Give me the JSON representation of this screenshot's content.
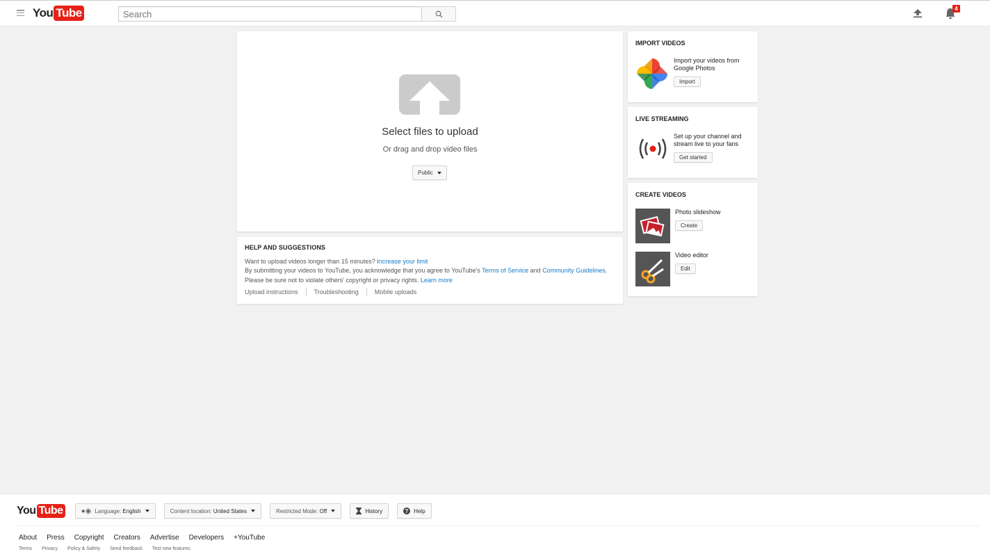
{
  "header": {
    "logo_you": "You",
    "logo_tube": "Tube",
    "search_placeholder": "Search",
    "notification_count": "4"
  },
  "upload": {
    "title": "Select files to upload",
    "subtitle": "Or drag and drop video files",
    "privacy_value": "Public"
  },
  "help": {
    "title": "HELP AND SUGGESTIONS",
    "line1_text": "Want to upload videos longer than 15 minutes? ",
    "line1_link": "Increase your limit",
    "line2_text": "By submitting your videos to YouTube, you acknowledge that you agree to YouTube's ",
    "line2_link1": "Terms of Service",
    "line2_and": " and ",
    "line2_link2": "Community Guidelines",
    "line2_end": ".",
    "line3_text": "Please be sure not to violate others' copyright or privacy rights. ",
    "line3_link": "Learn more",
    "links": [
      "Upload instructions",
      "Troubleshooting",
      "Mobile uploads"
    ]
  },
  "import_videos": {
    "title": "IMPORT VIDEOS",
    "text": "Import your videos from Google Photos",
    "button": "Import"
  },
  "live_streaming": {
    "title": "LIVE STREAMING",
    "text": "Set up your channel and stream live to your fans",
    "button": "Get started"
  },
  "create_videos": {
    "title": "CREATE VIDEOS",
    "items": [
      {
        "label": "Photo slideshow",
        "button": "Create"
      },
      {
        "label": "Video editor",
        "button": "Edit"
      }
    ]
  },
  "footer": {
    "language_label": "Language:",
    "language_value": "English",
    "location_label": "Content location:",
    "location_value": "United States",
    "restricted_label": "Restricted Mode:",
    "restricted_value": "Off",
    "history": "History",
    "help": "Help",
    "links_primary": [
      "About",
      "Press",
      "Copyright",
      "Creators",
      "Advertise",
      "Developers",
      "+YouTube"
    ],
    "links_secondary": [
      "Terms",
      "Privacy",
      "Policy & Safety",
      "Send feedback",
      "Test new features"
    ]
  },
  "colors": {
    "brand_red": "#e62117",
    "link_blue": "#167ac6",
    "page_bg": "#f1f1f1"
  }
}
